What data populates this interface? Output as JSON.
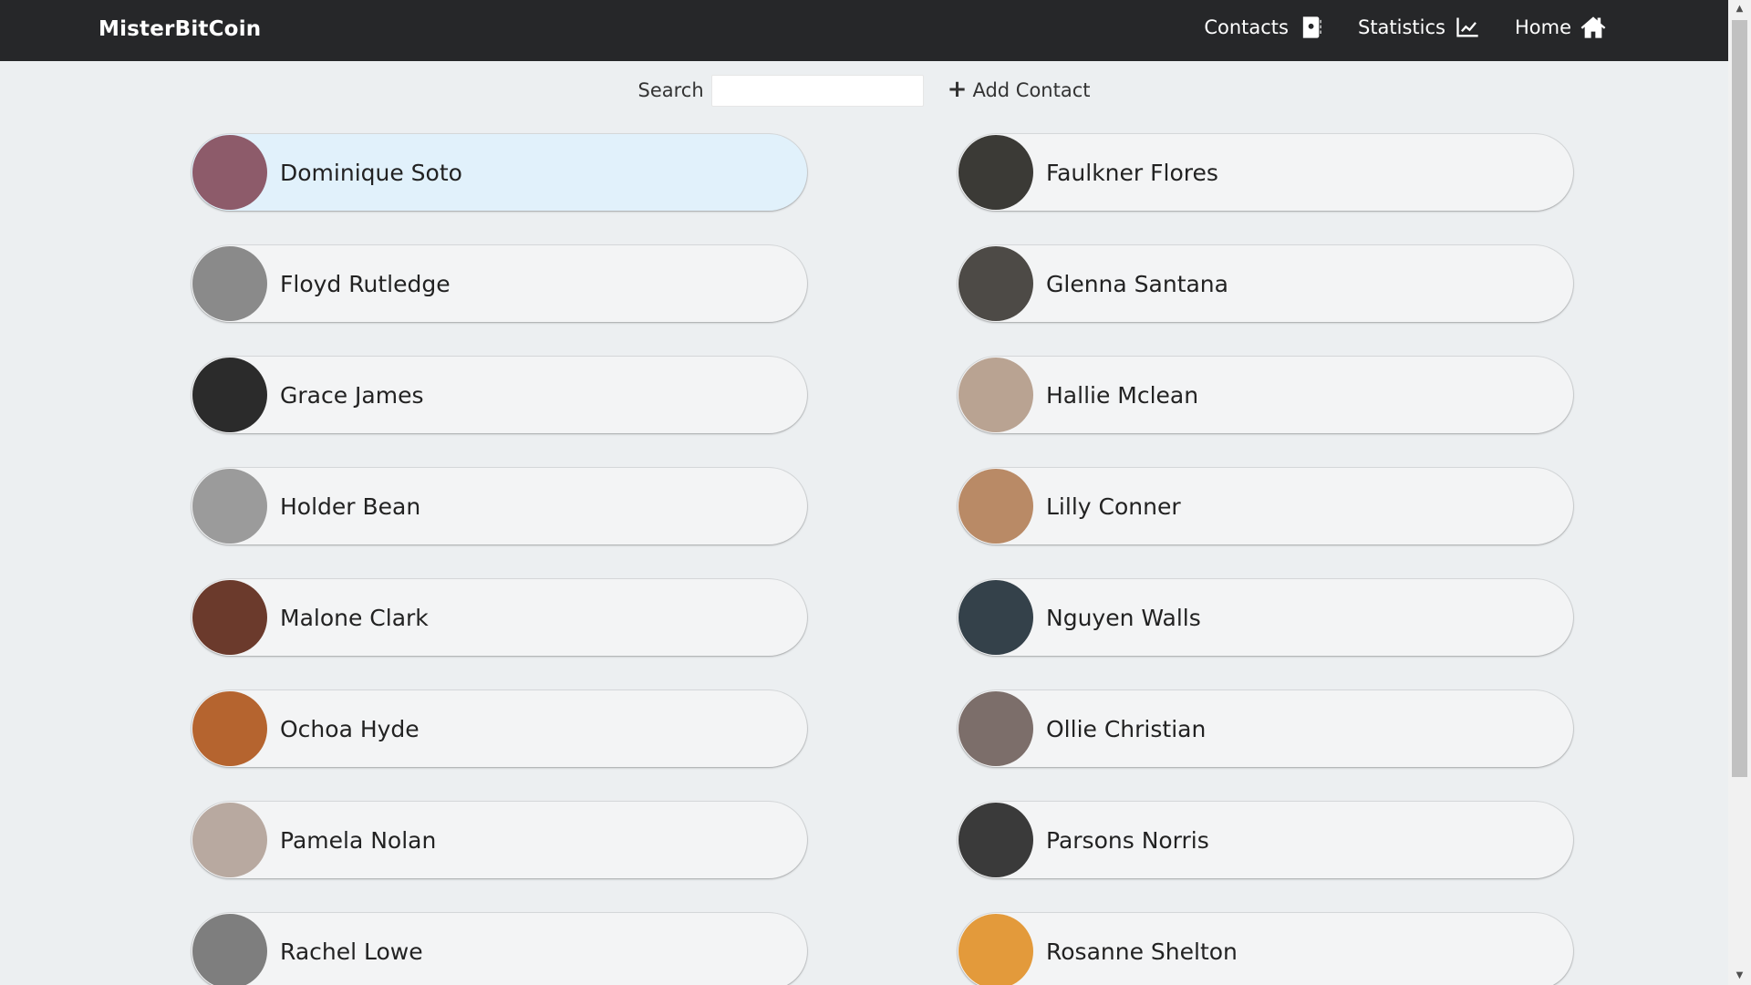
{
  "nav": {
    "brand": "MisterBitCoin",
    "links": [
      {
        "label": "Contacts",
        "icon": "address-card-icon"
      },
      {
        "label": "Statistics",
        "icon": "chart-line-icon"
      },
      {
        "label": "Home",
        "icon": "home-icon"
      }
    ]
  },
  "toolbar": {
    "search_label": "Search",
    "search_value": "",
    "add_contact_label": "Add Contact",
    "add_icon": "plus-icon"
  },
  "contacts": [
    {
      "name": "Dominique Soto",
      "selected": true,
      "avatar_color": "#8d5b6a"
    },
    {
      "name": "Faulkner Flores",
      "selected": false,
      "avatar_color": "#3b3a36"
    },
    {
      "name": "Floyd Rutledge",
      "selected": false,
      "avatar_color": "#8a8a8a"
    },
    {
      "name": "Glenna Santana",
      "selected": false,
      "avatar_color": "#4d4a46"
    },
    {
      "name": "Grace James",
      "selected": false,
      "avatar_color": "#2b2b2b"
    },
    {
      "name": "Hallie Mclean",
      "selected": false,
      "avatar_color": "#b9a392"
    },
    {
      "name": "Holder Bean",
      "selected": false,
      "avatar_color": "#9b9b9b"
    },
    {
      "name": "Lilly Conner",
      "selected": false,
      "avatar_color": "#b98a66"
    },
    {
      "name": "Malone Clark",
      "selected": false,
      "avatar_color": "#6b3a2c"
    },
    {
      "name": "Nguyen Walls",
      "selected": false,
      "avatar_color": "#34414a"
    },
    {
      "name": "Ochoa Hyde",
      "selected": false,
      "avatar_color": "#b5642f"
    },
    {
      "name": "Ollie Christian",
      "selected": false,
      "avatar_color": "#7c6e6a"
    },
    {
      "name": "Pamela Nolan",
      "selected": false,
      "avatar_color": "#b8a9a0"
    },
    {
      "name": "Parsons Norris",
      "selected": false,
      "avatar_color": "#3a3a3a"
    },
    {
      "name": "Rachel Lowe",
      "selected": false,
      "avatar_color": "#7e7e7e"
    },
    {
      "name": "Rosanne Shelton",
      "selected": false,
      "avatar_color": "#e39a3b"
    }
  ]
}
